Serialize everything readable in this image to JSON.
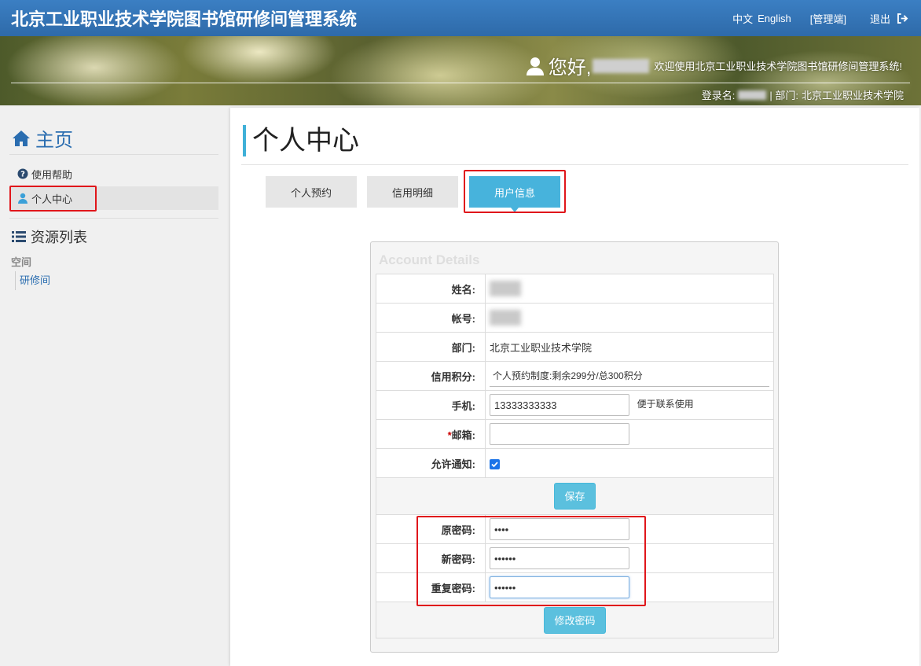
{
  "app": {
    "title": "北京工业职业技术学院图书馆研修间管理系统",
    "lang_zh": "中文",
    "lang_en": "English",
    "admin_link": "[管理端]",
    "logout": "退出"
  },
  "banner": {
    "hello": "您好,",
    "welcome": "欢迎使用北京工业职业技术学院图书馆研修间管理系统!",
    "login_label": "登录名:",
    "dept_label": "| 部门:",
    "dept_value": "北京工业职业技术学院"
  },
  "sidebar": {
    "home": "主页",
    "items": [
      {
        "label": "使用帮助",
        "icon": "question-circle-icon"
      },
      {
        "label": "个人中心",
        "icon": "user-icon"
      }
    ],
    "resources": "资源列表",
    "category": "空间",
    "sub_item": "研修间"
  },
  "main": {
    "page_title": "个人中心",
    "tabs": [
      {
        "label": "个人预约",
        "active": false
      },
      {
        "label": "信用明细",
        "active": false
      },
      {
        "label": "用户信息",
        "active": true
      }
    ],
    "account": {
      "header": "Account Details",
      "name_label": "姓名:",
      "account_label": "帐号:",
      "dept_label": "部门:",
      "dept_value": "北京工业职业技术学院",
      "credit_label": "信用积分:",
      "credit_value": "个人预约制度:剩余299分/总300积分",
      "phone_label": "手机:",
      "phone_value": "13333333333",
      "phone_hint": "便于联系使用",
      "email_star": "*",
      "email_label": "邮箱:",
      "email_value": "",
      "notify_label": "允许通知:",
      "save_button": "保存",
      "old_pwd_label": "原密码:",
      "old_pwd_value": "••••",
      "new_pwd_label": "新密码:",
      "new_pwd_value": "••••••",
      "repeat_pwd_label": "重复密码:",
      "repeat_pwd_value": "••••••",
      "change_pwd_button": "修改密码"
    }
  },
  "colors": {
    "navbar": "#2e6aa9",
    "accent": "#47b3dc",
    "button": "#5bc0de",
    "highlight": "#e0161b",
    "link": "#2a6db0"
  }
}
